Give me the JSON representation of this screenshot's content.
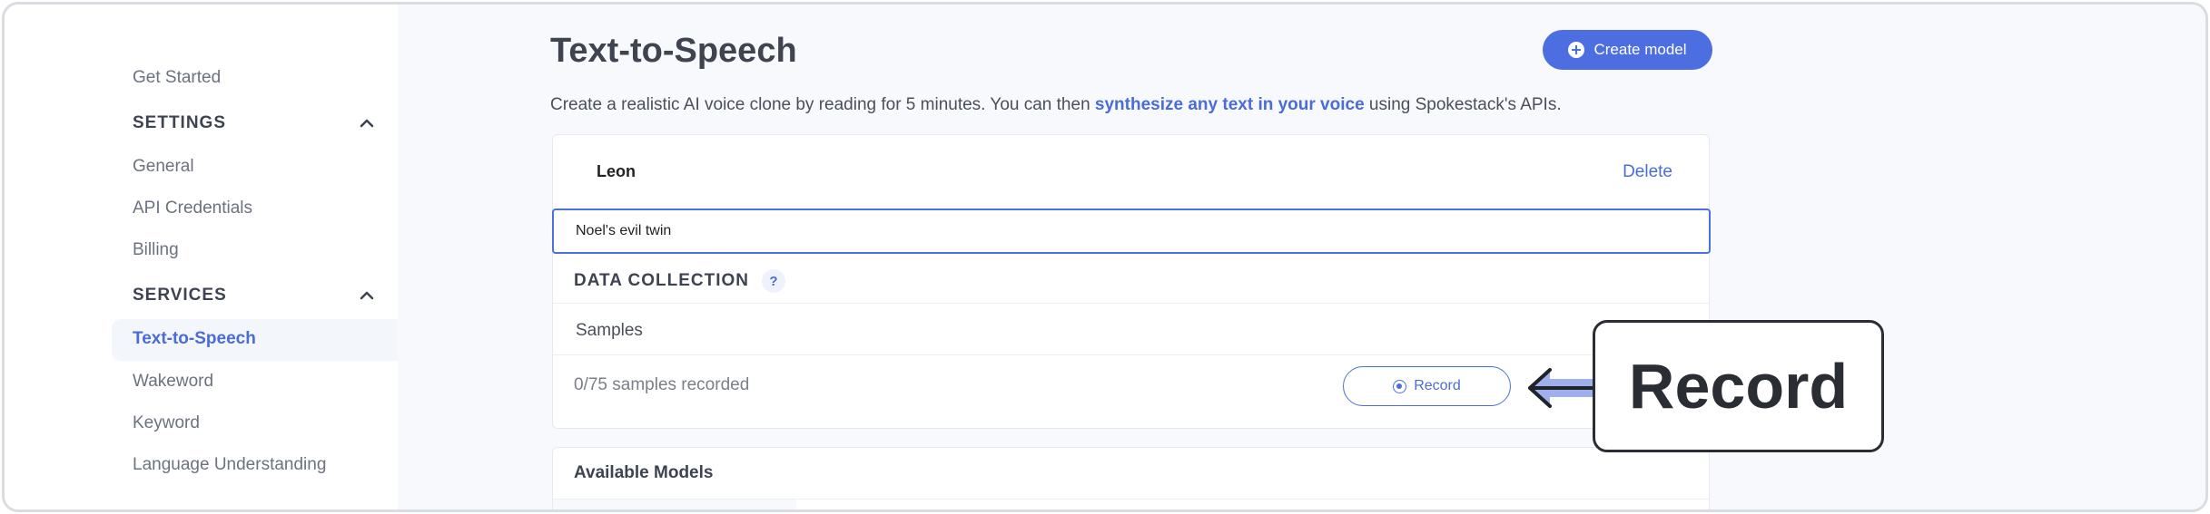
{
  "sidebar": {
    "get_started": "Get Started",
    "settings_header": "SETTINGS",
    "settings_items": [
      "General",
      "API Credentials",
      "Billing"
    ],
    "services_header": "SERVICES",
    "services_items": [
      "Text-to-Speech",
      "Wakeword",
      "Keyword",
      "Language Understanding"
    ],
    "active_item": "Text-to-Speech"
  },
  "header": {
    "title": "Text-to-Speech",
    "create_button": "Create model",
    "description_before": "Create a realistic AI voice clone by reading for 5 minutes. You can then ",
    "description_link": "synthesize any text in your voice",
    "description_after": " using Spokestack's APIs."
  },
  "model_card": {
    "name": "Leon",
    "delete_label": "Delete",
    "name_input_value": "Noel's evil twin",
    "data_collection_header": "DATA COLLECTION",
    "help_icon": "?",
    "samples_label": "Samples",
    "samples_count": "0/75 samples recorded",
    "record_button": "Record"
  },
  "available_models": {
    "title": "Available Models"
  },
  "callout": {
    "text": "Record"
  },
  "colors": {
    "accent": "#4d6ee0",
    "active_nav": "#4a6cd9",
    "arrow_fill": "#9fb0ec",
    "callout_border": "#2a2d33"
  }
}
